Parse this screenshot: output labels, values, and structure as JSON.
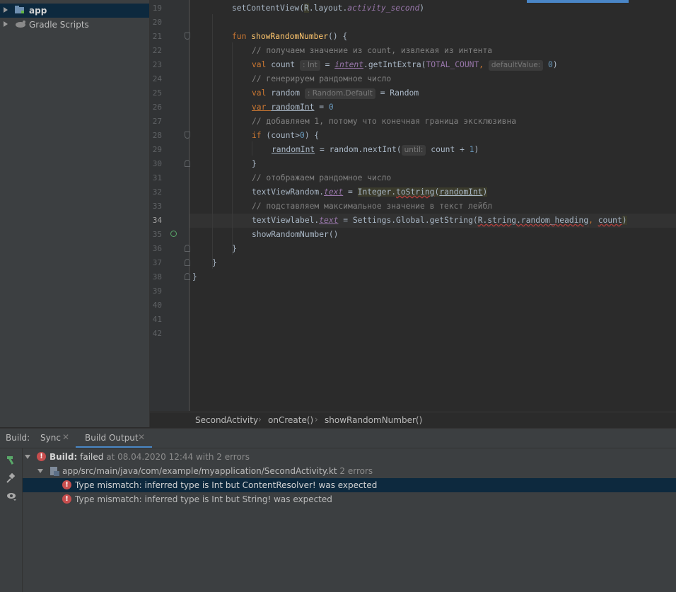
{
  "sidebar": {
    "items": [
      {
        "label": "app"
      },
      {
        "label": "Gradle Scripts"
      }
    ]
  },
  "editor": {
    "line_numbers": [
      "19",
      "20",
      "21",
      "22",
      "23",
      "24",
      "25",
      "26",
      "27",
      "28",
      "29",
      "30",
      "31",
      "32",
      "33",
      "34",
      "35",
      "36",
      "37",
      "38",
      "39",
      "40",
      "41",
      "42"
    ],
    "current_line": "34",
    "code": {
      "l19": {
        "a": "setContentView(",
        "b": "R",
        "c": ".layout.",
        "d": "activity_second",
        "e": ")"
      },
      "l21": {
        "kw": "fun ",
        "fn": "showRandomNumber",
        "rest": "() {"
      },
      "l22": "// получаем значение из count, извлекая из интента",
      "l23": {
        "kw": "val ",
        "name": "count",
        "hint": ": Int",
        "eq": " = ",
        "intent": "intent",
        "call": ".getIntExtra(",
        "const": "TOTAL_COUNT",
        "comma": ", ",
        "hint2": "defaultValue:",
        "num": "0",
        "close": ")"
      },
      "l24": "// генерируем рандомное число",
      "l25": {
        "kw": "val ",
        "name": "random",
        "hint": ": Random.Default",
        "rest": " = Random"
      },
      "l26": {
        "kw": "var ",
        "name": "randomInt",
        "eq": " = ",
        "num": "0"
      },
      "l27": "// добавляем 1, потому что конечная граница эксклюзивна",
      "l28": {
        "kw": "if ",
        "rest": "(count>",
        "num": "0",
        "rest2": ") {"
      },
      "l29": {
        "name": "randomInt",
        "mid": " = random.nextInt(",
        "hint": "until:",
        "rest": " count + ",
        "num": "1",
        "close": ")"
      },
      "l30": "}",
      "l31": "// отображаем рандомное число",
      "l32": {
        "a": "textViewRandom.",
        "prop": "text",
        "b": " = ",
        "c": "Integer.",
        "d": "toString",
        "e": "(",
        "f": "randomInt",
        "g": ")"
      },
      "l33": "// подставляем максимальное значение в текст лейбл",
      "l34": {
        "a": "textViewlabel.",
        "prop": "text",
        "b": " = Settings.Global.getString(",
        "c": "R.string.random_heading",
        "d": ", ",
        "e": "count",
        "f": ")"
      },
      "l35": "showRandomNumber()",
      "l36": "}",
      "l37": "}",
      "l38": "}"
    }
  },
  "breadcrumb": [
    "SecondActivity",
    "onCreate()",
    "showRandomNumber()"
  ],
  "build": {
    "tabs": {
      "label": "Build:",
      "sync": "Sync",
      "output": "Build Output"
    },
    "summary": {
      "bold": "Build:",
      "status": " failed",
      "detail": " at 08.04.2020 12:44 with 2 errors"
    },
    "file": {
      "path": "app/src/main/java/com/example/myapplication/SecondActivity.kt",
      "count": "2 errors"
    },
    "errors": [
      "Type mismatch: inferred type is Int but ContentResolver! was expected",
      "Type mismatch: inferred type is Int but String! was expected"
    ]
  },
  "colors": {
    "error": "#c74e4e",
    "selection": "#0d293e",
    "keyword": "#cc7832",
    "function": "#ffc66d",
    "comment": "#808080",
    "number": "#6897bb"
  }
}
